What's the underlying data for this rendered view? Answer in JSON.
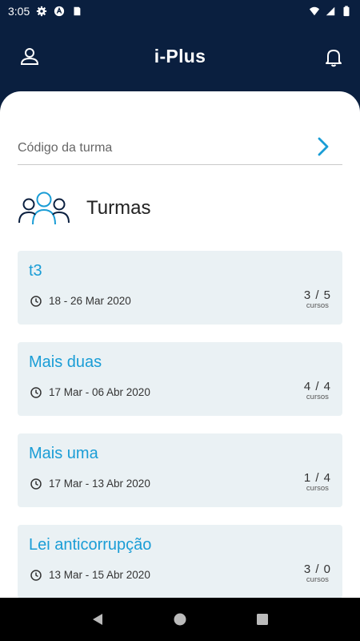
{
  "status_bar": {
    "time": "3:05",
    "left_icons": [
      "gear-icon",
      "app-a-icon",
      "sd-card-icon"
    ],
    "right_icons": [
      "wifi-icon",
      "signal-icon",
      "battery-icon"
    ]
  },
  "app_bar": {
    "title": "i-Plus",
    "left_icon": "person-icon",
    "right_icon": "bell-icon"
  },
  "code_field": {
    "value": "",
    "placeholder": "Código da turma",
    "submit_icon": "chevron-right-icon"
  },
  "section": {
    "icon": "group-icon",
    "title": "Turmas"
  },
  "classes": [
    {
      "title": "t3",
      "dates": "18 - 26 Mar 2020",
      "count": "3 / 5",
      "count_label": "cursos"
    },
    {
      "title": "Mais duas",
      "dates": "17 Mar - 06 Abr 2020",
      "count": "4 / 4",
      "count_label": "cursos"
    },
    {
      "title": "Mais uma",
      "dates": "17 Mar - 13 Abr 2020",
      "count": "1 / 4",
      "count_label": "cursos"
    },
    {
      "title": "Lei anticorrupção",
      "dates": "13 Mar - 15 Abr 2020",
      "count": "3 / 0",
      "count_label": "cursos"
    }
  ],
  "nav_bar": {
    "icons": [
      "back-icon",
      "home-icon",
      "recents-icon"
    ]
  },
  "colors": {
    "header_bg": "#0a1f3f",
    "accent": "#1a9dd6",
    "card_bg": "#eaf1f4"
  }
}
